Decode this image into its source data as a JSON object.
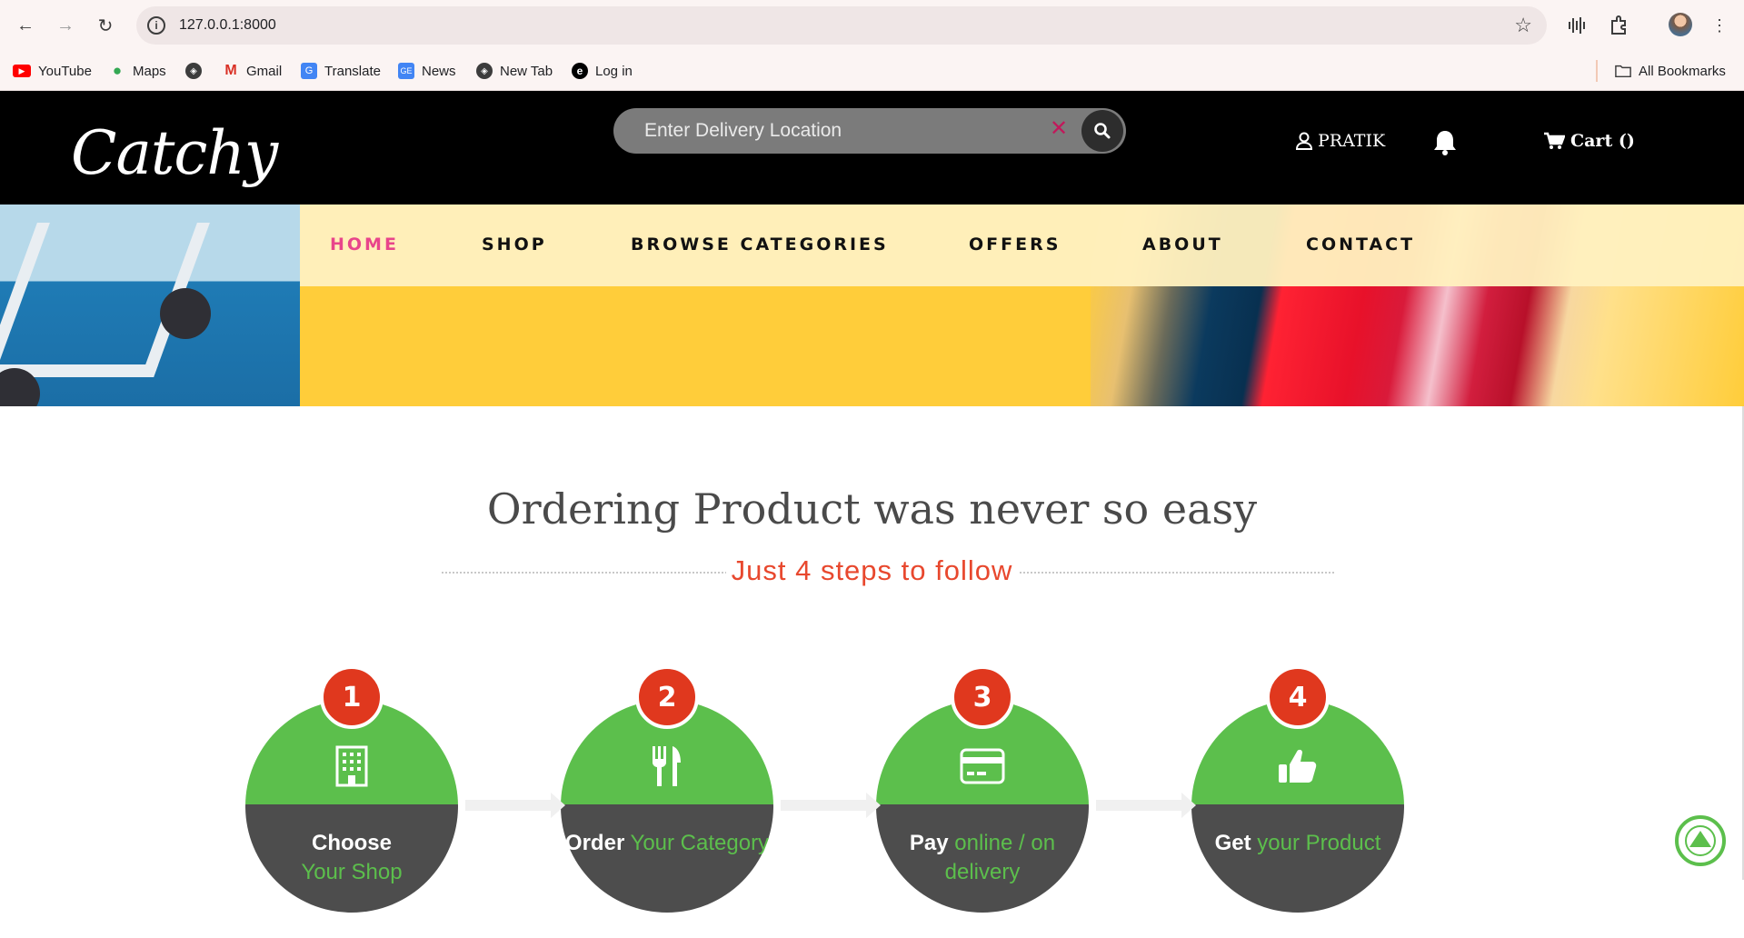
{
  "browser": {
    "url": "127.0.0.1:8000",
    "bookmarks": [
      {
        "label": "YouTube",
        "icon": "youtube-icon"
      },
      {
        "label": "Maps",
        "icon": "maps-icon"
      },
      {
        "label": "",
        "icon": "globe-icon"
      },
      {
        "label": "Gmail",
        "icon": "gmail-icon"
      },
      {
        "label": "Translate",
        "icon": "translate-icon"
      },
      {
        "label": "News",
        "icon": "news-icon"
      },
      {
        "label": "New Tab",
        "icon": "globe-icon"
      },
      {
        "label": "Log in",
        "icon": "edge-icon"
      }
    ],
    "all_bookmarks": "All Bookmarks"
  },
  "header": {
    "logo": "Catchy",
    "search_placeholder": "Enter Delivery Location",
    "user_name": "PRATIK",
    "cart_label": "Cart ()"
  },
  "nav": {
    "items": [
      {
        "label": "HOME",
        "active": true
      },
      {
        "label": "SHOP",
        "active": false
      },
      {
        "label": "BROWSE CATEGORIES",
        "active": false
      },
      {
        "label": "OFFERS",
        "active": false
      },
      {
        "label": "ABOUT",
        "active": false
      },
      {
        "label": "CONTACT",
        "active": false
      }
    ]
  },
  "steps_section": {
    "title": "Ordering Product was never so easy",
    "subtitle": "Just 4 steps to follow",
    "steps": [
      {
        "number": "1",
        "icon": "building-icon",
        "bold": "Choose",
        "accent": "Your Shop"
      },
      {
        "number": "2",
        "icon": "fork-knife-icon",
        "bold": "Order",
        "accent": "Your Category"
      },
      {
        "number": "3",
        "icon": "credit-card-icon",
        "bold": "Pay",
        "accent": "online / on delivery"
      },
      {
        "number": "4",
        "icon": "thumbs-up-icon",
        "bold": "Get",
        "accent": "your Product"
      }
    ]
  },
  "colors": {
    "accent_green": "#5cbf4c",
    "step_number_red": "#e0381e",
    "nav_active_pink": "#e8458b",
    "hero_yellow": "#ffcd3a"
  }
}
